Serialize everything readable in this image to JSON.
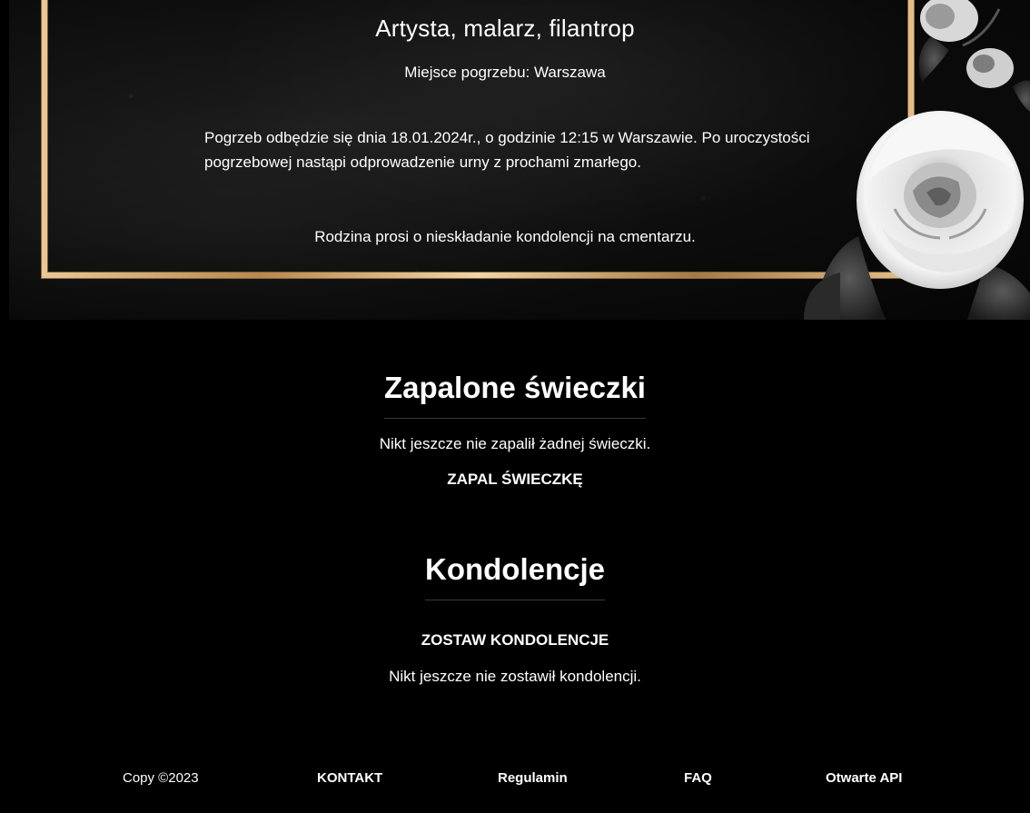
{
  "obituary": {
    "subtitle": "Artysta, malarz, filantrop",
    "burial_place": "Miejsce pogrzebu: Warszawa",
    "funeral_info": "Pogrzeb odbędzie się dnia 18.01.2024r., o godzinie 12:15 w Warszawie. Po uroczystości pogrzebowej nastąpi odprowadzenie urny z prochami zmarłego.",
    "family_request": "Rodzina prosi o nieskładanie kondolencji na cmentarzu."
  },
  "candles": {
    "heading": "Zapalone świeczki",
    "empty_message": "Nikt jeszcze nie zapalił żadnej świeczki.",
    "action_label": "ZAPAL ŚWIECZKĘ"
  },
  "condolences": {
    "heading": "Kondolencje",
    "action_label": "ZOSTAW KONDOLENCJE",
    "empty_message": "Nikt jeszcze nie zostawił kondolencji."
  },
  "footer": {
    "copyright": "Copy ©2023",
    "links": [
      "KONTAKT",
      "Regulamin",
      "FAQ",
      "Otwarte API"
    ]
  },
  "colors": {
    "background": "#000000",
    "frame_gold": "#c9a36a",
    "text": "#ffffff"
  }
}
